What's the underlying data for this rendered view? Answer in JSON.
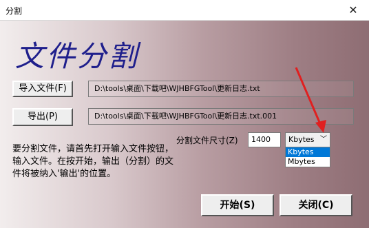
{
  "window": {
    "title": "分割",
    "close_glyph": "✕"
  },
  "heading": "文件分割",
  "import_button": {
    "label": "导入文件(F)"
  },
  "input_path": "D:\\tools\\桌面\\下载吧\\WJHBFGTool\\更新日志.txt",
  "export_button": {
    "label": "导出(P)"
  },
  "output_path": "D:\\tools\\桌面\\下载吧\\WJHBFGTool\\更新日志.txt.001",
  "description": "要分割文件，请首先打开输入文件按钮，输入文件。在按开始，输出（分割）的文件将被纳入'输出'的位置。",
  "split_size": {
    "label": "分割文件尺寸(Z)",
    "value": "1400",
    "unit_selected": "Kbytes",
    "unit_options": [
      "Kbytes",
      "Mbytes"
    ]
  },
  "start_button": {
    "label": "开始(S)"
  },
  "close_button": {
    "label": "关闭(C)"
  },
  "colors": {
    "heading": "#1f1f8c",
    "arrow": "#e02020",
    "highlight": "#0078d7"
  }
}
